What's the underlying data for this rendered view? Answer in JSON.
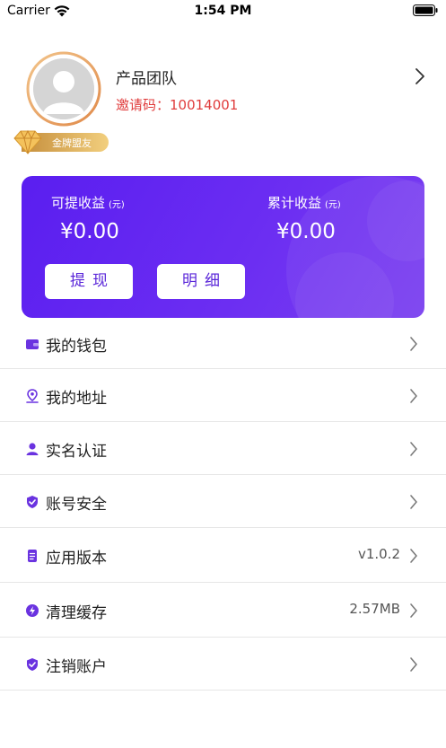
{
  "status_bar": {
    "carrier": "Carrier",
    "time": "1:54 PM"
  },
  "profile": {
    "team_name": "产品团队",
    "invite_code": "邀请码：10014001",
    "badge": "金牌盟友"
  },
  "earnings": {
    "available_label": "可提收益",
    "available_unit": "(元)",
    "available_amount": "¥0.00",
    "total_label": "累计收益",
    "total_unit": "(元)",
    "total_amount": "¥0.00",
    "withdraw_button": "提现",
    "detail_button": "明细"
  },
  "colors": {
    "accent": "#5a1ef0",
    "icon": "#6a33e0",
    "invite_text": "#e03c3c",
    "badge_gold": "#e0b560"
  },
  "menu": [
    {
      "label": "我的钱包",
      "icon": "wallet-icon",
      "value": ""
    },
    {
      "label": "我的地址",
      "icon": "location-icon",
      "value": ""
    },
    {
      "label": "实名认证",
      "icon": "user-verify-icon",
      "value": ""
    },
    {
      "label": "账号安全",
      "icon": "shield-check-icon",
      "value": ""
    },
    {
      "label": "应用版本",
      "icon": "document-icon",
      "value": "v1.0.2"
    },
    {
      "label": "清理缓存",
      "icon": "lightning-icon",
      "value": "2.57MB"
    },
    {
      "label": "注销账户",
      "icon": "shield-check-icon",
      "value": ""
    }
  ]
}
